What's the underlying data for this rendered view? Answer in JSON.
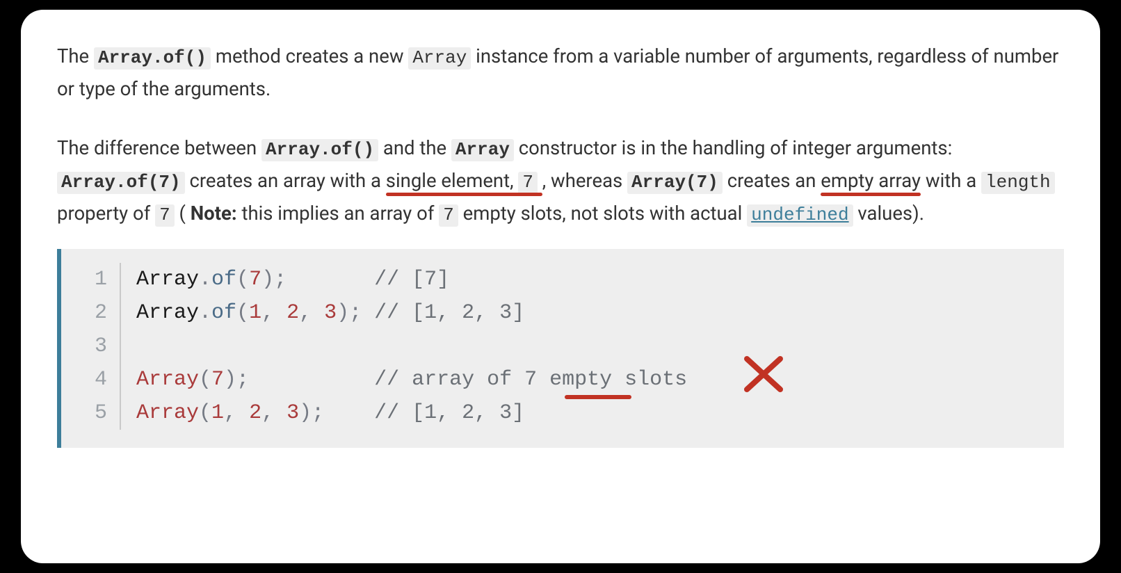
{
  "para1": {
    "t1": "The ",
    "code1": "Array.of()",
    "t2": " method creates a new ",
    "code2": "Array",
    "t3": " instance from a variable number of arguments, regardless of number or type of the arguments."
  },
  "para2": {
    "t1": "The difference between ",
    "code1": "Array.of()",
    "t2": " and the ",
    "code2": "Array",
    "t3": " constructor is in the handling of integer arguments: ",
    "code3": "Array.of(7)",
    "t4": " creates an array with a ",
    "ul1": "single element, ",
    "code4": "7",
    "t5": ", whereas ",
    "code5": "Array(7)",
    "t6": " creates an ",
    "ul2": "empty array",
    "t7": " with a ",
    "code6": "length",
    "ul3_rest": " property of ",
    "code7": "7",
    "t8": " (",
    "note": "Note:",
    "t9": " this implies an array of ",
    "code8": "7",
    "t10": " empty slots, not slots with actual ",
    "code9": "undefined",
    "t11": " values)."
  },
  "code": {
    "lines": {
      "n1": "1",
      "n2": "2",
      "n3": "3",
      "n4": "4",
      "n5": "5"
    },
    "l1": {
      "obj": "Array",
      "dot": ".",
      "method": "of",
      "open": "(",
      "arg": "7",
      "close": ");",
      "pad": "       ",
      "comment": "// [7]"
    },
    "l2": {
      "obj": "Array",
      "dot": ".",
      "method": "of",
      "open": "(",
      "a1": "1",
      "c1": ", ",
      "a2": "2",
      "c2": ", ",
      "a3": "3",
      "close": "); ",
      "comment": "// [1, 2, 3]"
    },
    "l3": {
      "blank": " "
    },
    "l4": {
      "call": "Array",
      "open": "(",
      "arg": "7",
      "close": ");",
      "pad": "          ",
      "comment": "// array of 7 empty slots"
    },
    "l5": {
      "call": "Array",
      "open": "(",
      "a1": "1",
      "c1": ", ",
      "a2": "2",
      "c2": ", ",
      "a3": "3",
      "close": ");",
      "pad": "    ",
      "comment": "// [1, 2, 3]"
    }
  },
  "annotations": {
    "underlines_in_text": [
      "single element, 7",
      "empty array",
      "length property of 7"
    ],
    "squiggle_near": "undefined",
    "code_underline_word": "empty",
    "code_cross_line": 4
  }
}
